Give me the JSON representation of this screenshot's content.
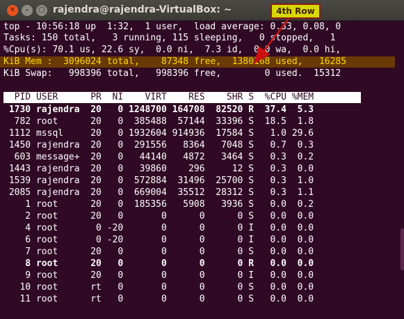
{
  "window": {
    "title": "rajendra@rajendra-VirtualBox: ~",
    "close_glyph": "✕",
    "min_glyph": "–",
    "max_glyph": "□"
  },
  "annotation": {
    "label": "4th Row",
    "color": "#d8d800",
    "border_color": "#8b1a1a"
  },
  "summary": {
    "line1": "top - 10:56:18 up  1:32,  1 user,  load average: 0.33, 0.08, 0",
    "line2": "Tasks: 150 total,   3 running, 115 sleeping,   0 stopped,   1",
    "line3": "%Cpu(s): 70.1 us, 22.6 sy,  0.0 ni,  7.3 id,  0.0 wa,  0.0 hi,",
    "line4": "KiB Mem :  3096024 total,    87348 free,  1380168 used,   16285",
    "line5": "KiB Swap:   998396 total,   998396 free,        0 used.  15312"
  },
  "table": {
    "header": "  PID USER      PR  NI    VIRT    RES    SHR S  %CPU %MEM",
    "rows": [
      {
        "text": " 1730 rajendra  20   0 1248700 164708  82520 R  37.4  5.3",
        "bold": true
      },
      {
        "text": "  782 root      20   0  385488  57144  33396 S  18.5  1.8",
        "bold": false
      },
      {
        "text": " 1112 mssql     20   0 1932604 914936  17584 S   1.0 29.6",
        "bold": false
      },
      {
        "text": " 1450 rajendra  20   0  291556   8364   7048 S   0.7  0.3",
        "bold": false
      },
      {
        "text": "  603 message+  20   0   44140   4872   3464 S   0.3  0.2",
        "bold": false
      },
      {
        "text": " 1443 rajendra  20   0   39860    296     12 S   0.3  0.0",
        "bold": false
      },
      {
        "text": " 1539 rajendra  20   0  572884  31496  25700 S   0.3  1.0",
        "bold": false
      },
      {
        "text": " 2085 rajendra  20   0  669004  35512  28312 S   0.3  1.1",
        "bold": false
      },
      {
        "text": "    1 root      20   0  185356   5908   3936 S   0.0  0.2",
        "bold": false
      },
      {
        "text": "    2 root      20   0       0      0      0 S   0.0  0.0",
        "bold": false
      },
      {
        "text": "    4 root       0 -20       0      0      0 I   0.0  0.0",
        "bold": false
      },
      {
        "text": "    6 root       0 -20       0      0      0 I   0.0  0.0",
        "bold": false
      },
      {
        "text": "    7 root      20   0       0      0      0 S   0.0  0.0",
        "bold": false
      },
      {
        "text": "    8 root      20   0       0      0      0 R   0.0  0.0",
        "bold": true
      },
      {
        "text": "    9 root      20   0       0      0      0 I   0.0  0.0",
        "bold": false
      },
      {
        "text": "   10 root      rt   0       0      0      0 S   0.0  0.0",
        "bold": false
      },
      {
        "text": "   11 root      rt   0       0      0      0 S   0.0  0.0",
        "bold": false
      }
    ]
  },
  "colors": {
    "terminal_bg": "#300a24",
    "mem_row_bg": "#6a3a05",
    "mem_row_fg": "#ffd800",
    "arrow": "#cc1111"
  }
}
